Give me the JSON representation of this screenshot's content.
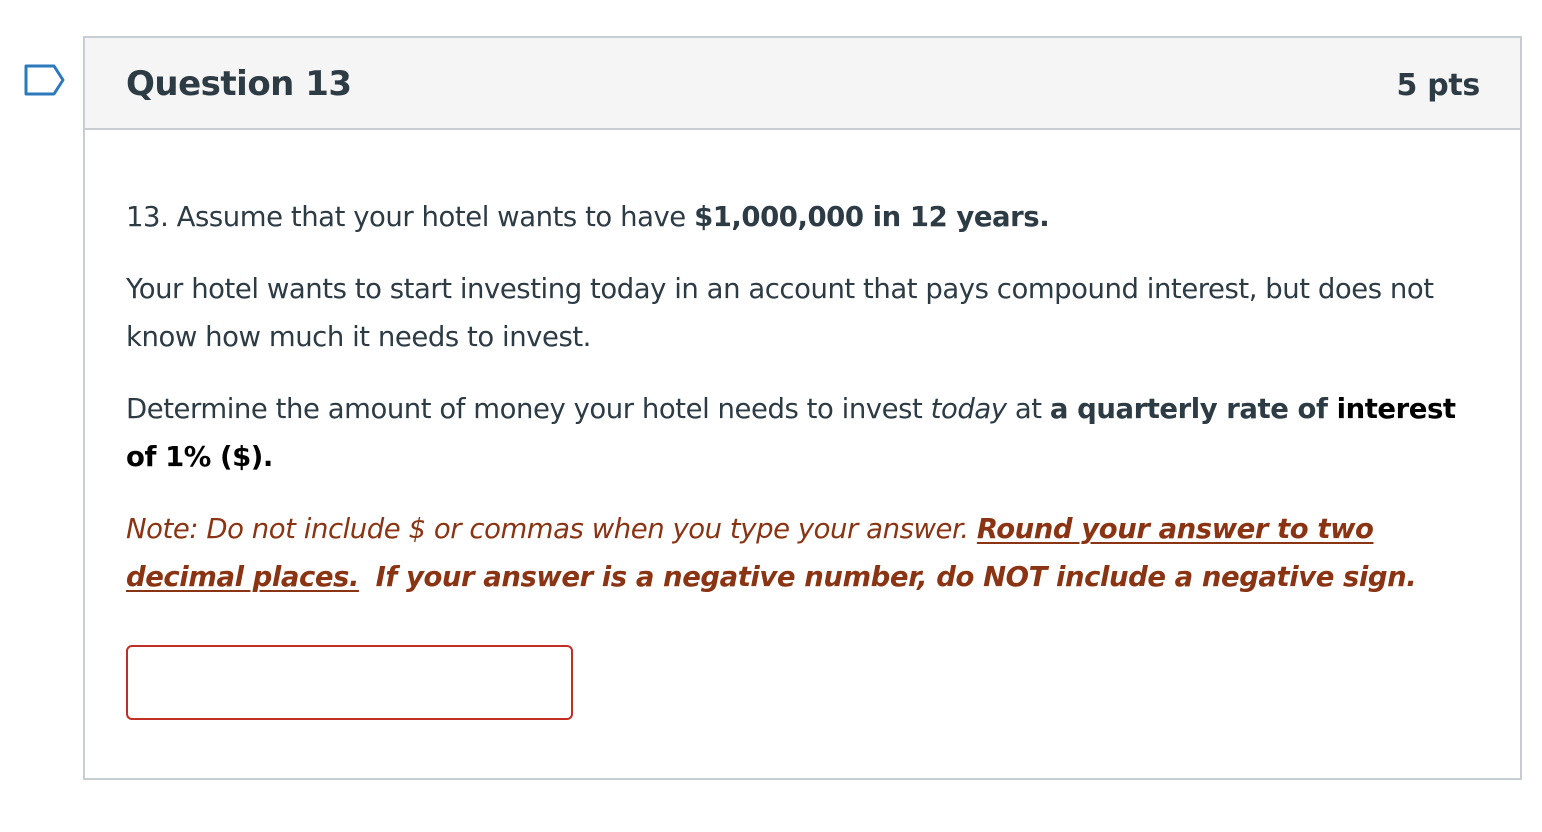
{
  "question": {
    "title": "Question 13",
    "points": "5 pts",
    "flag_icon": "bookmark-flag-icon"
  },
  "body": {
    "p1_prefix": "13. Assume that your hotel wants to have ",
    "p1_bold": "$1,000,000 in 12 years.",
    "p2": "Your hotel wants to start investing today in an account that pays compound interest, but does not know how much it needs to invest.",
    "p3_prefix": "Determine the amount of money your hotel needs to invest ",
    "p3_italic": "today",
    "p3_mid": " at ",
    "p3_bold": "a quarterly rate of ",
    "p3_bold_black": "interest",
    "p3_bold_end": "of 1% ($).",
    "note_prefix": "Note: Do not include $ or commas when you type your answer. ",
    "note_underlined": "Round your answer to two decimal places.",
    "note_bold": "If your answer is a negative number, do NOT include a negative sign."
  },
  "answer": {
    "value": "",
    "placeholder": ""
  },
  "colors": {
    "text": "#2d3b45",
    "note": "#8b3413",
    "input_border": "#c02e24",
    "header_bg": "#f5f5f5",
    "border": "#c7cdd1"
  }
}
